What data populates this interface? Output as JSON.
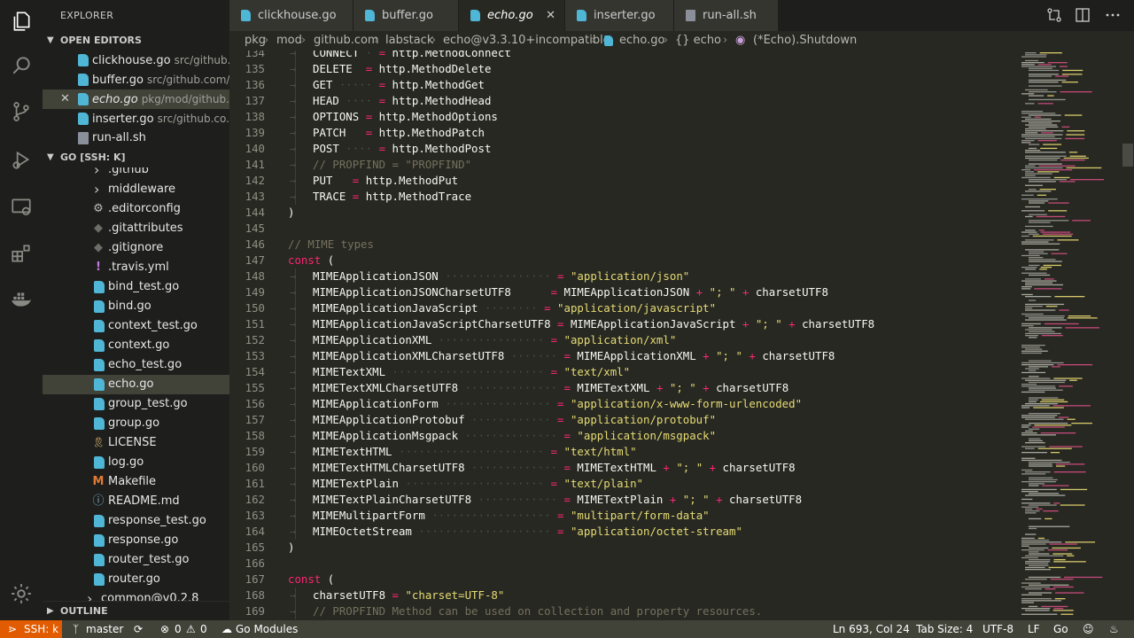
{
  "explorer": {
    "title": "EXPLORER",
    "open_editors_label": "OPEN EDITORS",
    "workspace_label": "GO [SSH: K]",
    "outline_label": "OUTLINE",
    "open_editors": [
      {
        "name": "clickhouse.go",
        "path": "src/github...",
        "type": "go"
      },
      {
        "name": "buffer.go",
        "path": "src/github.com/...",
        "type": "go"
      },
      {
        "name": "echo.go",
        "path": "pkg/mod/github....",
        "type": "go",
        "active": true
      },
      {
        "name": "inserter.go",
        "path": "src/github.co...",
        "type": "go"
      },
      {
        "name": "run-all.sh",
        "path": "",
        "type": "sh"
      }
    ],
    "tree": [
      {
        "name": ".github",
        "type": "folder"
      },
      {
        "name": "middleware",
        "type": "folder"
      },
      {
        "name": ".editorconfig",
        "type": "gear"
      },
      {
        "name": ".gitattributes",
        "type": "diamond"
      },
      {
        "name": ".gitignore",
        "type": "diamond"
      },
      {
        "name": ".travis.yml",
        "type": "yml"
      },
      {
        "name": "bind_test.go",
        "type": "go"
      },
      {
        "name": "bind.go",
        "type": "go"
      },
      {
        "name": "context_test.go",
        "type": "go"
      },
      {
        "name": "context.go",
        "type": "go"
      },
      {
        "name": "echo_test.go",
        "type": "go"
      },
      {
        "name": "echo.go",
        "type": "go",
        "active": true
      },
      {
        "name": "group_test.go",
        "type": "go"
      },
      {
        "name": "group.go",
        "type": "go"
      },
      {
        "name": "LICENSE",
        "type": "license"
      },
      {
        "name": "log.go",
        "type": "go"
      },
      {
        "name": "Makefile",
        "type": "make"
      },
      {
        "name": "README.md",
        "type": "info"
      },
      {
        "name": "response_test.go",
        "type": "go"
      },
      {
        "name": "response.go",
        "type": "go"
      },
      {
        "name": "router_test.go",
        "type": "go"
      },
      {
        "name": "router.go",
        "type": "go"
      },
      {
        "name": "common@v0.2.8",
        "type": "folder"
      }
    ]
  },
  "tabs": [
    {
      "label": "clickhouse.go"
    },
    {
      "label": "buffer.go"
    },
    {
      "label": "echo.go",
      "active": true
    },
    {
      "label": "inserter.go"
    },
    {
      "label": "run-all.sh"
    }
  ],
  "breadcrumb": [
    "pkg",
    "mod",
    "github.com",
    "labstack",
    "echo@v3.3.10+incompatible",
    "echo.go",
    "{} echo",
    "(*Echo).Shutdown"
  ],
  "editor": {
    "lines": [
      {
        "n": "134",
        "segs": [
          [
            "t",
            "CONNECT"
          ],
          [
            "ws",
            " · "
          ],
          [
            "op",
            "="
          ],
          [
            "t",
            " http.MethodConnect"
          ]
        ]
      },
      {
        "n": "135",
        "segs": [
          [
            "t",
            "DELETE"
          ],
          [
            "ws",
            "  "
          ],
          [
            "op",
            "="
          ],
          [
            "t",
            " http.MethodDelete"
          ]
        ]
      },
      {
        "n": "136",
        "segs": [
          [
            "t",
            "GET"
          ],
          [
            "ws",
            " ····· "
          ],
          [
            "op",
            "="
          ],
          [
            "t",
            " http.MethodGet"
          ]
        ]
      },
      {
        "n": "137",
        "segs": [
          [
            "t",
            "HEAD"
          ],
          [
            "ws",
            " ···· "
          ],
          [
            "op",
            "="
          ],
          [
            "t",
            " http.MethodHead"
          ]
        ]
      },
      {
        "n": "138",
        "segs": [
          [
            "t",
            "OPTIONS"
          ],
          [
            "ws",
            " "
          ],
          [
            "op",
            "="
          ],
          [
            "t",
            " http.MethodOptions"
          ]
        ]
      },
      {
        "n": "139",
        "segs": [
          [
            "t",
            "PATCH"
          ],
          [
            "ws",
            "   "
          ],
          [
            "op",
            "="
          ],
          [
            "t",
            " http.MethodPatch"
          ]
        ]
      },
      {
        "n": "140",
        "segs": [
          [
            "t",
            "POST"
          ],
          [
            "ws",
            " ···· "
          ],
          [
            "op",
            "="
          ],
          [
            "t",
            " http.MethodPost"
          ]
        ]
      },
      {
        "n": "141",
        "segs": [
          [
            "cmt",
            "// PROPFIND = \"PROPFIND\""
          ]
        ]
      },
      {
        "n": "142",
        "segs": [
          [
            "t",
            "PUT"
          ],
          [
            "ws",
            "   "
          ],
          [
            "op",
            "="
          ],
          [
            "t",
            " http.MethodPut"
          ]
        ]
      },
      {
        "n": "143",
        "segs": [
          [
            "t",
            "TRACE"
          ],
          [
            "ws",
            " "
          ],
          [
            "op",
            "="
          ],
          [
            "t",
            " http.MethodTrace"
          ]
        ]
      },
      {
        "n": "144",
        "segs": [
          [
            "t",
            ")"
          ]
        ],
        "outdent": true
      },
      {
        "n": "145",
        "segs": []
      },
      {
        "n": "146",
        "segs": [
          [
            "cmt",
            "// MIME types"
          ]
        ],
        "outdent": true
      },
      {
        "n": "147",
        "segs": [
          [
            "kw",
            "const"
          ],
          [
            "t",
            " ("
          ]
        ],
        "outdent": true
      },
      {
        "n": "148",
        "segs": [
          [
            "t",
            "MIMEApplicationJSON"
          ],
          [
            "ws",
            " ················ "
          ],
          [
            "op",
            "="
          ],
          [
            "str",
            " \"application/json\""
          ]
        ]
      },
      {
        "n": "149",
        "segs": [
          [
            "t",
            "MIMEApplicationJSONCharsetUTF8"
          ],
          [
            "ws",
            "      "
          ],
          [
            "op",
            "="
          ],
          [
            "t",
            " MIMEApplicationJSON "
          ],
          [
            "op",
            "+"
          ],
          [
            "str",
            " \"; \""
          ],
          [
            "op",
            " +"
          ],
          [
            "t",
            " charsetUTF8"
          ]
        ]
      },
      {
        "n": "150",
        "segs": [
          [
            "t",
            "MIMEApplicationJavaScript"
          ],
          [
            "ws",
            " ········ "
          ],
          [
            "op",
            "="
          ],
          [
            "str",
            " \"application/javascript\""
          ]
        ]
      },
      {
        "n": "151",
        "segs": [
          [
            "t",
            "MIMEApplicationJavaScriptCharsetUTF8"
          ],
          [
            "ws",
            " "
          ],
          [
            "op",
            "="
          ],
          [
            "t",
            " MIMEApplicationJavaScript "
          ],
          [
            "op",
            "+"
          ],
          [
            "str",
            " \"; \""
          ],
          [
            "op",
            " +"
          ],
          [
            "t",
            " charsetUTF8"
          ]
        ]
      },
      {
        "n": "152",
        "segs": [
          [
            "t",
            "MIMEApplicationXML"
          ],
          [
            "ws",
            " ················ "
          ],
          [
            "op",
            "="
          ],
          [
            "str",
            " \"application/xml\""
          ]
        ]
      },
      {
        "n": "153",
        "segs": [
          [
            "t",
            "MIMEApplicationXMLCharsetUTF8"
          ],
          [
            "ws",
            " ······· "
          ],
          [
            "op",
            "="
          ],
          [
            "t",
            " MIMEApplicationXML "
          ],
          [
            "op",
            "+"
          ],
          [
            "str",
            " \"; \""
          ],
          [
            "op",
            " +"
          ],
          [
            "t",
            " charsetUTF8"
          ]
        ]
      },
      {
        "n": "154",
        "segs": [
          [
            "t",
            "MIMETextXML"
          ],
          [
            "ws",
            " ······················· "
          ],
          [
            "op",
            "="
          ],
          [
            "str",
            " \"text/xml\""
          ]
        ]
      },
      {
        "n": "155",
        "segs": [
          [
            "t",
            "MIMETextXMLCharsetUTF8"
          ],
          [
            "ws",
            " ·············· "
          ],
          [
            "op",
            "="
          ],
          [
            "t",
            " MIMETextXML "
          ],
          [
            "op",
            "+"
          ],
          [
            "str",
            " \"; \""
          ],
          [
            "op",
            " +"
          ],
          [
            "t",
            " charsetUTF8"
          ]
        ]
      },
      {
        "n": "156",
        "segs": [
          [
            "t",
            "MIMEApplicationForm"
          ],
          [
            "ws",
            " ················ "
          ],
          [
            "op",
            "="
          ],
          [
            "str",
            " \"application/x-www-form-urlencoded\""
          ]
        ]
      },
      {
        "n": "157",
        "segs": [
          [
            "t",
            "MIMEApplicationProtobuf"
          ],
          [
            "ws",
            " ············ "
          ],
          [
            "op",
            "="
          ],
          [
            "str",
            " \"application/protobuf\""
          ]
        ]
      },
      {
        "n": "158",
        "segs": [
          [
            "t",
            "MIMEApplicationMsgpack"
          ],
          [
            "ws",
            " ·············· "
          ],
          [
            "op",
            "="
          ],
          [
            "str",
            " \"application/msgpack\""
          ]
        ]
      },
      {
        "n": "159",
        "segs": [
          [
            "t",
            "MIMETextHTML"
          ],
          [
            "ws",
            " ······················ "
          ],
          [
            "op",
            "="
          ],
          [
            "str",
            " \"text/html\""
          ]
        ]
      },
      {
        "n": "160",
        "segs": [
          [
            "t",
            "MIMETextHTMLCharsetUTF8"
          ],
          [
            "ws",
            " ············· "
          ],
          [
            "op",
            "="
          ],
          [
            "t",
            " MIMETextHTML "
          ],
          [
            "op",
            "+"
          ],
          [
            "str",
            " \"; \""
          ],
          [
            "op",
            " +"
          ],
          [
            "t",
            " charsetUTF8"
          ]
        ]
      },
      {
        "n": "161",
        "segs": [
          [
            "t",
            "MIMETextPlain"
          ],
          [
            "ws",
            " ····················· "
          ],
          [
            "op",
            "="
          ],
          [
            "str",
            " \"text/plain\""
          ]
        ]
      },
      {
        "n": "162",
        "segs": [
          [
            "t",
            "MIMETextPlainCharsetUTF8"
          ],
          [
            "ws",
            " ············ "
          ],
          [
            "op",
            "="
          ],
          [
            "t",
            " MIMETextPlain "
          ],
          [
            "op",
            "+"
          ],
          [
            "str",
            " \"; \""
          ],
          [
            "op",
            " +"
          ],
          [
            "t",
            " charsetUTF8"
          ]
        ]
      },
      {
        "n": "163",
        "segs": [
          [
            "t",
            "MIMEMultipartForm"
          ],
          [
            "ws",
            " ·················· "
          ],
          [
            "op",
            "="
          ],
          [
            "str",
            " \"multipart/form-data\""
          ]
        ]
      },
      {
        "n": "164",
        "segs": [
          [
            "t",
            "MIMEOctetStream"
          ],
          [
            "ws",
            " ···················· "
          ],
          [
            "op",
            "="
          ],
          [
            "str",
            " \"application/octet-stream\""
          ]
        ]
      },
      {
        "n": "165",
        "segs": [
          [
            "t",
            ")"
          ]
        ],
        "outdent": true
      },
      {
        "n": "166",
        "segs": []
      },
      {
        "n": "167",
        "segs": [
          [
            "kw",
            "const"
          ],
          [
            "t",
            " ("
          ]
        ],
        "outdent": true
      },
      {
        "n": "168",
        "segs": [
          [
            "t",
            "charsetUTF8"
          ],
          [
            "ws",
            " "
          ],
          [
            "op",
            "="
          ],
          [
            "str",
            " \"charset=UTF-8\""
          ]
        ]
      },
      {
        "n": "169",
        "segs": [
          [
            "cmt",
            "// PROPFIND Method can be used on collection and property resources."
          ]
        ]
      }
    ]
  },
  "status": {
    "remote": "SSH: k",
    "branch": "master",
    "errors": "0",
    "warnings": "0",
    "modules": "Go Modules",
    "position": "Ln 693, Col 24",
    "tab_size": "Tab Size: 4",
    "encoding": "UTF-8",
    "eol": "LF",
    "language": "Go"
  }
}
